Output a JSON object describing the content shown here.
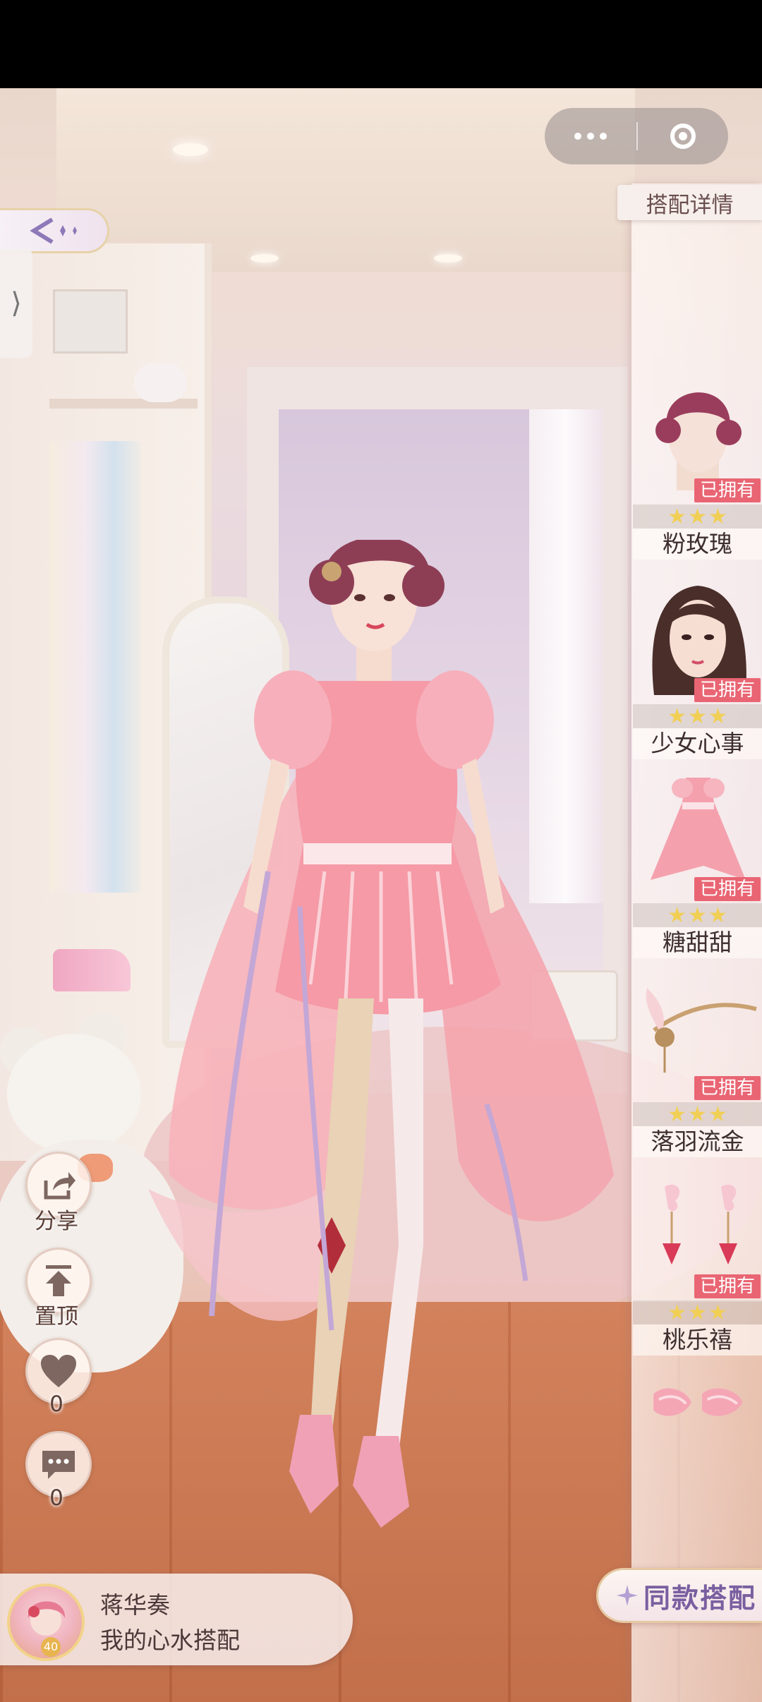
{
  "capsule": {
    "more_icon": "more-dots-icon",
    "close_icon": "target-circle-icon"
  },
  "panel": {
    "title": "搭配详情",
    "owned_label": "已拥有",
    "items": [
      {
        "name": "粉玫瑰",
        "category_icon": "hair-icon",
        "stars": 3,
        "owned": true
      },
      {
        "name": "少女心事",
        "category_icon": "makeup-face-icon",
        "stars": 3,
        "owned": true
      },
      {
        "name": "糖甜甜",
        "category_icon": "dress-icon",
        "stars": 3,
        "owned": true
      },
      {
        "name": "落羽流金",
        "category_icon": "headpiece-icon",
        "stars": 3,
        "owned": true
      },
      {
        "name": "桃乐禧",
        "category_icon": "earrings-icon",
        "stars": 3,
        "owned": true
      },
      {
        "name": "",
        "category_icon": "wrist-cuffs-icon",
        "stars": 0,
        "owned": false
      }
    ]
  },
  "actions": {
    "share_label": "分享",
    "pin_label": "置顶",
    "like_count": "0",
    "comment_count": "0"
  },
  "user": {
    "name": "蒋华奏",
    "outfit_title": "我的心水搭配",
    "level": "40"
  },
  "same_outfit_label": "同款搭配",
  "colors": {
    "accent_pink": "#e96573",
    "star_gold": "#f1cf55",
    "button_purple": "#7a5fa0"
  }
}
